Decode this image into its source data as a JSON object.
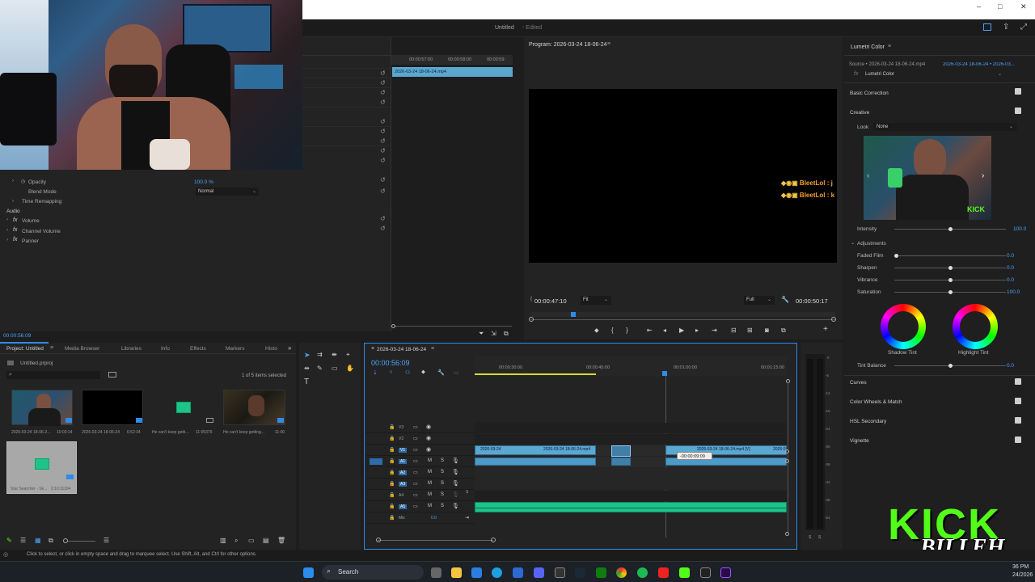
{
  "app": {
    "title": "Untitled",
    "status": "- Edited"
  },
  "window_controls": [
    "–",
    "□",
    "✕"
  ],
  "effect_controls": {
    "source_clip": "2026-03-24 18-06-24.mp4",
    "ruler": [
      "00:00:57:00",
      "00:00:58:00",
      "00:00:59:"
    ],
    "opacity_label": "Opacity",
    "opacity_value": "100.0 %",
    "blend_label": "Blend Mode",
    "blend_value": "Normal",
    "time_remap": "Time Remapping",
    "audio_header": "Audio",
    "volume": "Volume",
    "channel_volume": "Channel Volume",
    "panner": "Panner",
    "timecode": "00:00:56:09"
  },
  "program_monitor": {
    "title": "Program: 2026-03-24 18-06-24",
    "chat_line1": "BleetLol : j",
    "chat_line2": "BleetLol : k",
    "timecode_left": "00:00:47:10",
    "fit": "Fit",
    "quality": "Full",
    "timecode_right": "00:00:50:17"
  },
  "lumetri": {
    "panel_title": "Lumetri Color",
    "source": "Source • 2026-03-24 18-06-24.mp4",
    "sequence": "2026-03-24 18-06-24 • 2026-03...",
    "fx_name": "Lumetri Color",
    "basic_correction": "Basic Correction",
    "creative": "Creative",
    "look_label": "Look",
    "look_value": "None",
    "intensity_label": "Intensity",
    "intensity_value": "100.0",
    "intensity_level": 1.0,
    "adjustments": "Adjustments",
    "faded_film": {
      "label": "Faded Film",
      "value": "0.0"
    },
    "sharpen": {
      "label": "Sharpen",
      "value": "0.0"
    },
    "vibrance": {
      "label": "Vibrance",
      "value": "0.0"
    },
    "saturation": {
      "label": "Saturation",
      "value": "100.0"
    },
    "shadow_tint": "Shadow Tint",
    "highlight_tint": "Highlight Tint",
    "tint_balance": {
      "label": "Tint Balance",
      "value": "0.0"
    },
    "sections": [
      "Curves",
      "Color Wheels & Match",
      "HSL Secondary",
      "Vignette"
    ]
  },
  "project": {
    "tabs": [
      "Project: Untitled",
      "Media Browser",
      "Libraries",
      "Info",
      "Effects",
      "Markers",
      "Histo"
    ],
    "file": "Untitled.prproj",
    "selection": "1 of 5 items selected",
    "items": [
      {
        "name": "2026-03-24 18-06-2...",
        "duration": "10:03:14"
      },
      {
        "name": "2026-03-24 18-06-24",
        "duration": "6:52:34"
      },
      {
        "name": "He can't keep getti...",
        "duration": "11:05376"
      },
      {
        "name": "He can't keep getting...",
        "duration": "11:00"
      },
      {
        "name": "Star Searcher - Sk...",
        "duration": "2:10:11104"
      }
    ]
  },
  "timeline": {
    "tab": "2026-03-24 18-06-24",
    "timecode": "00:00:56:09",
    "ruler": [
      "00:00:30:00",
      "00:00:45:00",
      "00:01:00:00",
      "00:01:15:00"
    ],
    "tracks": [
      "V3",
      "V2",
      "V1",
      "A1",
      "A2",
      "A3",
      "A4",
      "A5"
    ],
    "mix_label": "Mix",
    "mix_value": "0.0",
    "clips": [
      "2026-03-24",
      "2026-03-24 18-06-24.mp4",
      "2026-03-24 18-06-24.mp4 [V]",
      "2026-0"
    ],
    "tooltip": "-00:00:09:09",
    "db_scale": [
      "0",
      "-6",
      "-12",
      "-18",
      "-24",
      "-30",
      "-36",
      "-42",
      "-48",
      "-54"
    ],
    "solo_labels": [
      "S",
      "S"
    ]
  },
  "status_bar": "Click to select, or click in empty space and drag to marquee select. Use Shift, Alt, and Ctrl for other options.",
  "taskbar": {
    "search": "Search",
    "clock1": "36 PM",
    "clock2": "24/2026"
  },
  "overlay": {
    "logo_top": "KICK",
    "logo_bottom": "BILLEH",
    "lumetri_thumb_logo": "KICK"
  },
  "colors": {
    "accent": "#2d8ceb",
    "clip": "#5aa7d0",
    "audio": "#1fc28a",
    "kick": "#53fc18"
  }
}
